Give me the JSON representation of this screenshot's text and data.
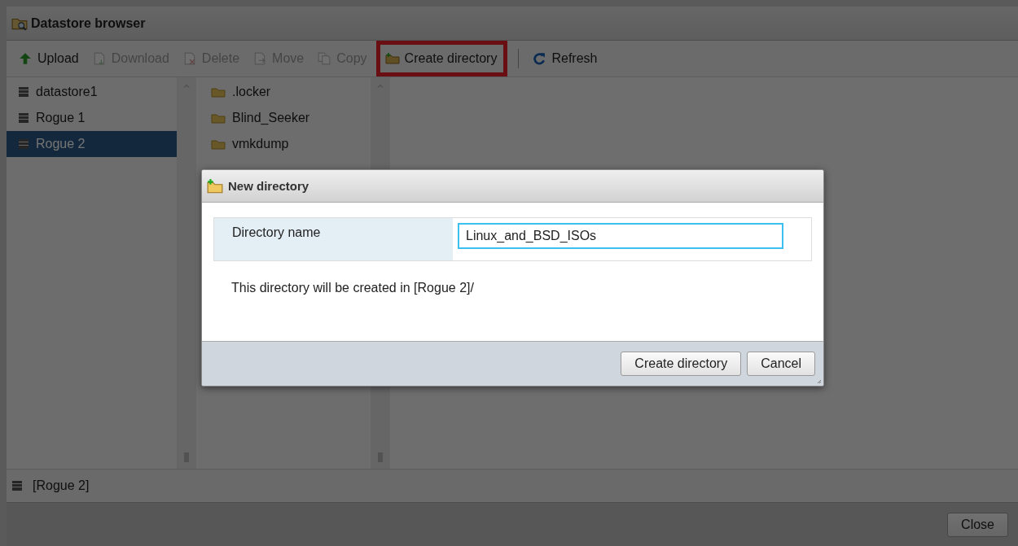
{
  "window": {
    "title": "Datastore browser"
  },
  "toolbar": [
    {
      "label": "Upload",
      "kind": "upload",
      "disabled": false,
      "highlighted": false
    },
    {
      "label": "Download",
      "kind": "download",
      "disabled": true,
      "highlighted": false
    },
    {
      "label": "Delete",
      "kind": "delete",
      "disabled": true,
      "highlighted": false
    },
    {
      "label": "Move",
      "kind": "move",
      "disabled": true,
      "highlighted": false
    },
    {
      "label": "Copy",
      "kind": "copy",
      "disabled": true,
      "highlighted": false
    },
    {
      "label": "Create directory",
      "kind": "folder",
      "disabled": false,
      "highlighted": true
    },
    {
      "label": "Refresh",
      "kind": "refresh",
      "disabled": false,
      "highlighted": false
    }
  ],
  "datastores": [
    {
      "name": "datastore1",
      "selected": false
    },
    {
      "name": "Rogue 1",
      "selected": false
    },
    {
      "name": "Rogue 2",
      "selected": true
    }
  ],
  "folders": [
    {
      "name": ".locker",
      "selected": false
    },
    {
      "name": "Blind_Seeker",
      "selected": false
    },
    {
      "name": "vmkdump",
      "selected": false
    }
  ],
  "status_bar": {
    "path": "[Rogue 2]"
  },
  "footer": {
    "button": "Close"
  },
  "dialog": {
    "title": "New directory",
    "field_label": "Directory name",
    "value": "Linux_and_BSD_ISOs",
    "note": "This directory will be created in [Rogue 2]/",
    "buttons": [
      "Create directory",
      "Cancel"
    ]
  }
}
